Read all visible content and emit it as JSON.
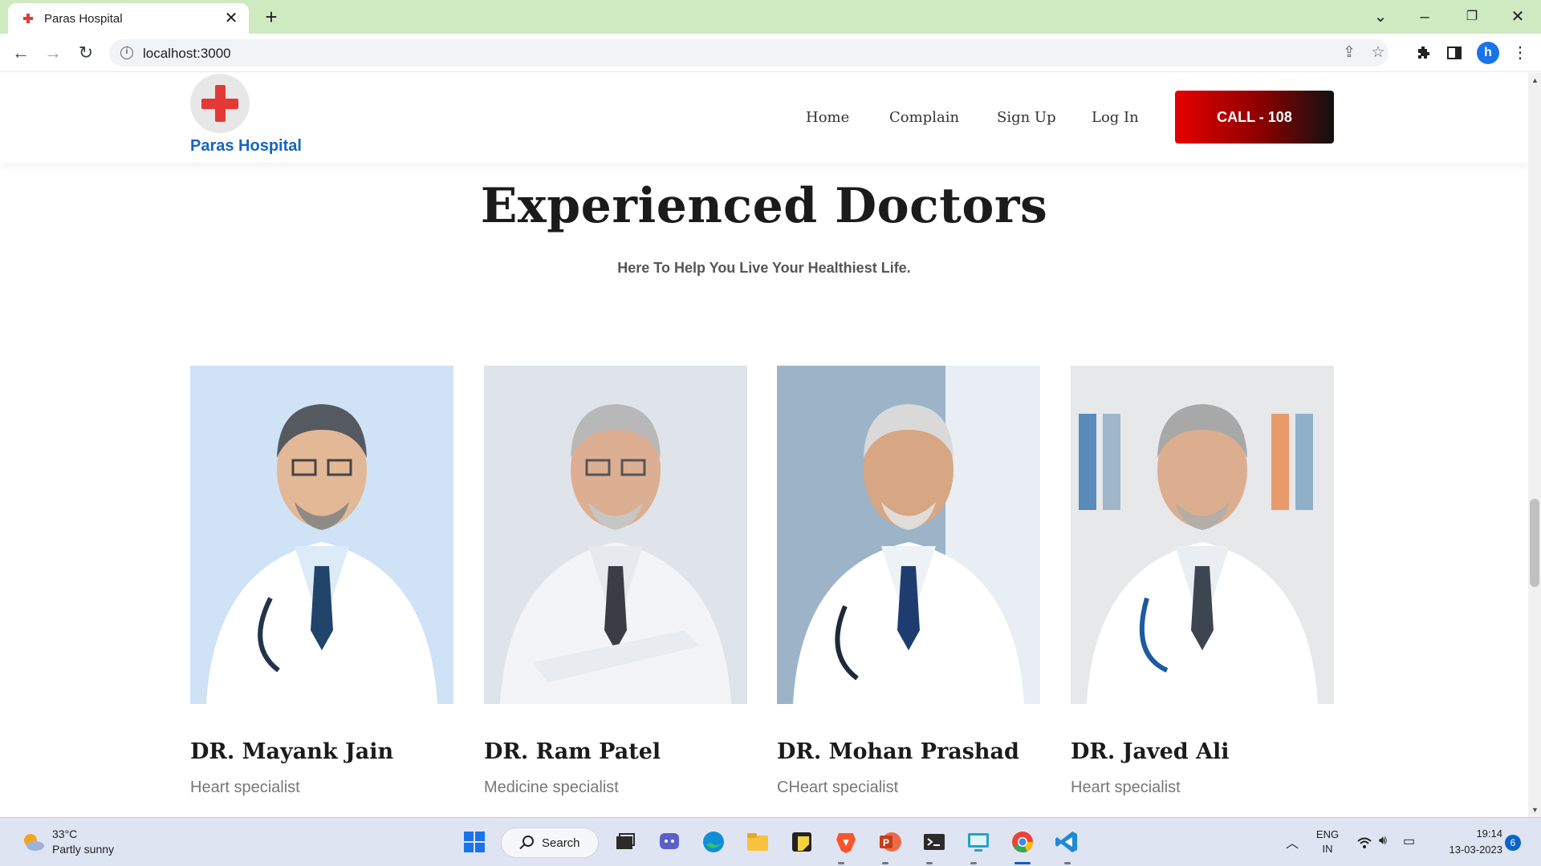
{
  "browser": {
    "tab_title": "Paras Hospital",
    "new_tab": "+",
    "url": "localhost:3000",
    "profile_initial": "h"
  },
  "site": {
    "logo_text": "Paras Hospital",
    "nav": [
      "Home",
      "Complain",
      "Sign Up",
      "Log In"
    ],
    "call_button": "CALL - 108"
  },
  "section": {
    "title": "Experienced Doctors",
    "subtitle": "Here To Help You Live Your Healthiest Life."
  },
  "doctors": [
    {
      "name": "DR. Mayank Jain",
      "specialty": "Heart specialist"
    },
    {
      "name": "DR. Ram Patel",
      "specialty": "Medicine specialist"
    },
    {
      "name": "DR. Mohan Prashad",
      "specialty": "CHeart specialist"
    },
    {
      "name": "DR. Javed Ali",
      "specialty": "Heart specialist"
    }
  ],
  "taskbar": {
    "weather_temp": "33°C",
    "weather_desc": "Partly sunny",
    "search_label": "Search",
    "lang_top": "ENG",
    "lang_bottom": "IN",
    "time": "19:14",
    "date": "13-03-2023",
    "notifications": "6"
  },
  "colors": {
    "brand_blue": "#1565c0",
    "call_red": "#e60000",
    "logo_cross": "#e53935"
  }
}
